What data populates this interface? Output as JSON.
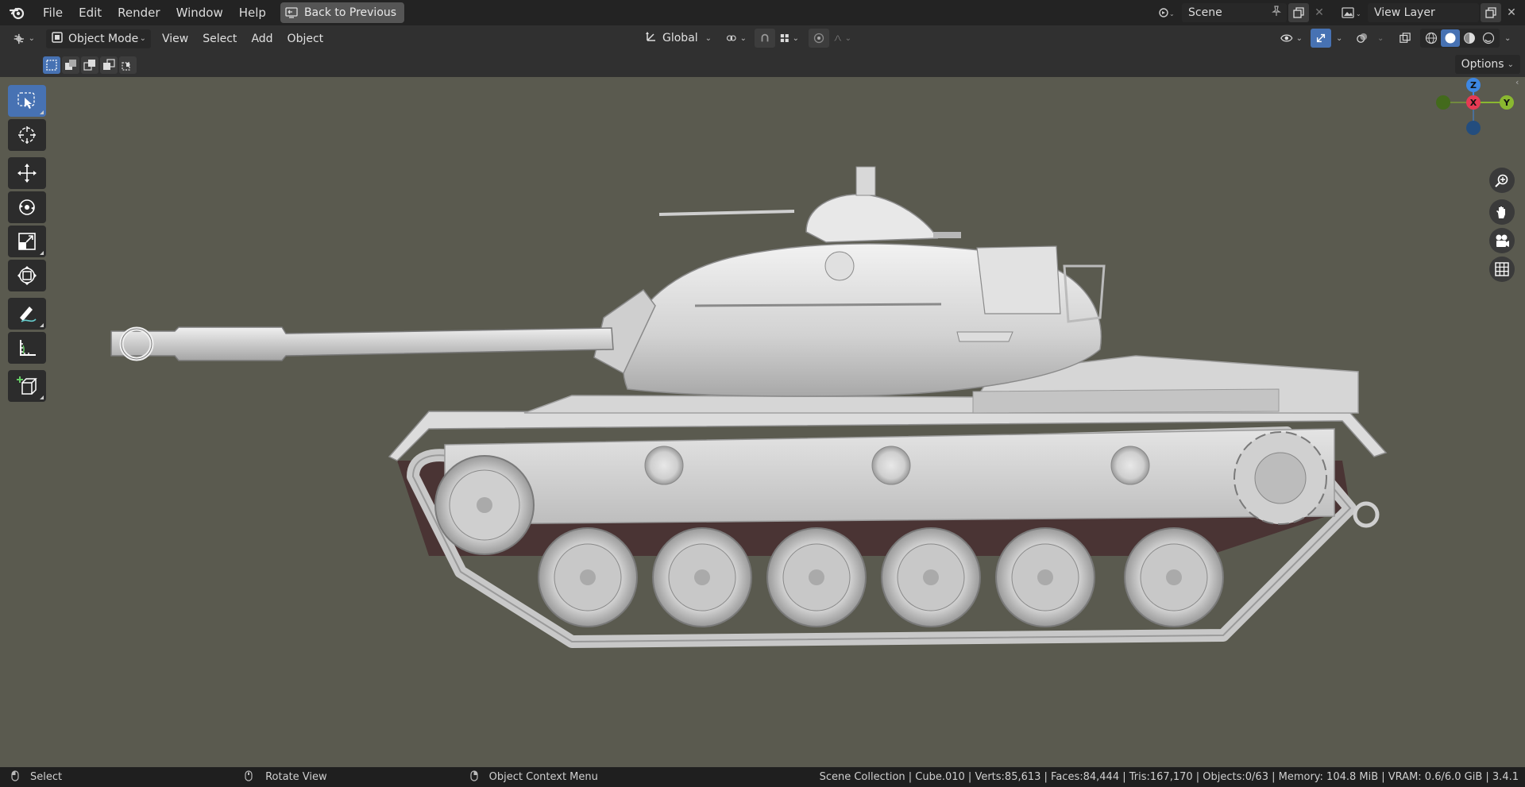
{
  "menu": {
    "items": [
      "File",
      "Edit",
      "Render",
      "Window",
      "Help"
    ],
    "back_label": "Back to Previous"
  },
  "scene": {
    "name": "Scene"
  },
  "view_layer": {
    "name": "View Layer"
  },
  "header": {
    "mode_label": "Object Mode",
    "menus": [
      "View",
      "Select",
      "Add",
      "Object"
    ],
    "orientation_label": "Global"
  },
  "options_label": "Options",
  "gizmo": {
    "z": "Z",
    "x": "X",
    "y": "Y"
  },
  "status": {
    "select": "Select",
    "rotate": "Rotate View",
    "context": "Object Context Menu",
    "stats": "Scene Collection | Cube.010 | Verts:85,613 | Faces:84,444 | Tris:167,170 | Objects:0/63 | Memory: 104.8 MiB | VRAM: 0.6/6.0 GiB | 3.4.1"
  },
  "colors": {
    "accent": "#4772b3",
    "viewport": "#5a5a4f",
    "axis_x": "#e63a53",
    "axis_y": "#8ab830",
    "axis_z": "#3d87e3"
  },
  "icons": [
    "blender-logo-icon",
    "back-icon",
    "scene-icon",
    "pin-icon",
    "copy-icon",
    "close-icon",
    "view-layer-icon",
    "editor-type-icon",
    "object-mode-icon",
    "orientation-icon",
    "pivot-icon",
    "snap-icon",
    "snap-grid-icon",
    "proportional-icon",
    "falloff-icon",
    "visibility-icon",
    "gizmo-icon",
    "overlay-icon",
    "xray-icon",
    "wireframe-shading-icon",
    "solid-shading-icon",
    "material-shading-icon",
    "rendered-shading-icon",
    "select-box-icon",
    "cursor-icon",
    "move-icon",
    "rotate-icon",
    "scale-icon",
    "transform-icon",
    "annotate-icon",
    "measure-icon",
    "add-cube-icon",
    "zoom-icon",
    "hand-pan-icon",
    "camera-icon",
    "grid-icon",
    "mouse-icon"
  ]
}
